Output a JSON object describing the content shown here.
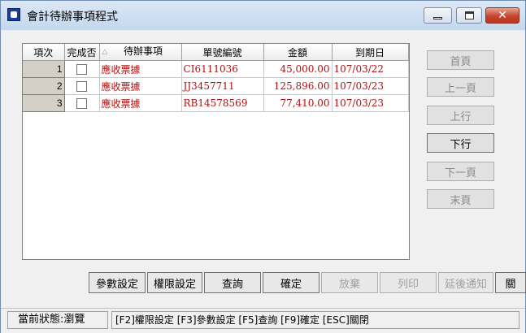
{
  "window": {
    "title": "會計待辦事項程式",
    "controls": {
      "minimize": "minimize-icon",
      "maximize": "maximize-icon",
      "close": "close-icon",
      "close_glyph": "✕"
    }
  },
  "grid": {
    "columns": [
      "項次",
      "完成否",
      "待辦事項",
      "單號編號",
      "金額",
      "到期日"
    ],
    "rows": [
      {
        "index": "1",
        "done": false,
        "item": "應收票據",
        "doc_no": "CI6111036",
        "amount": "45,000.00",
        "due": "107/03/22"
      },
      {
        "index": "2",
        "done": false,
        "item": "應收票據",
        "doc_no": "JJ3457711",
        "amount": "125,896.00",
        "due": "107/03/23"
      },
      {
        "index": "3",
        "done": false,
        "item": "應收票據",
        "doc_no": "RB14578569",
        "amount": "77,410.00",
        "due": "107/03/23"
      }
    ]
  },
  "nav_buttons": [
    {
      "label": "首頁",
      "enabled": false
    },
    {
      "label": "上一頁",
      "enabled": false
    },
    {
      "label": "上行",
      "enabled": false
    },
    {
      "label": "下行",
      "enabled": true
    },
    {
      "label": "下一頁",
      "enabled": false
    },
    {
      "label": "末頁",
      "enabled": false
    }
  ],
  "action_buttons": [
    {
      "label": "參數設定",
      "enabled": true
    },
    {
      "label": "權限設定",
      "enabled": true
    },
    {
      "label": "查詢",
      "enabled": true
    },
    {
      "label": "確定",
      "enabled": true
    },
    {
      "label": "放棄",
      "enabled": false
    },
    {
      "label": "列印",
      "enabled": false
    },
    {
      "label": "延後通知",
      "enabled": false
    },
    {
      "label": "關",
      "enabled": true
    }
  ],
  "status": {
    "state": "當前狀態:瀏覽",
    "hotkeys": "[F2]權限設定 [F3]參數設定 [F5]查詢 [F9]確定 [ESC]關閉"
  },
  "colors": {
    "data_text": "#b01010",
    "title_bar": "#c4d7ee",
    "close_button": "#c6452d"
  }
}
